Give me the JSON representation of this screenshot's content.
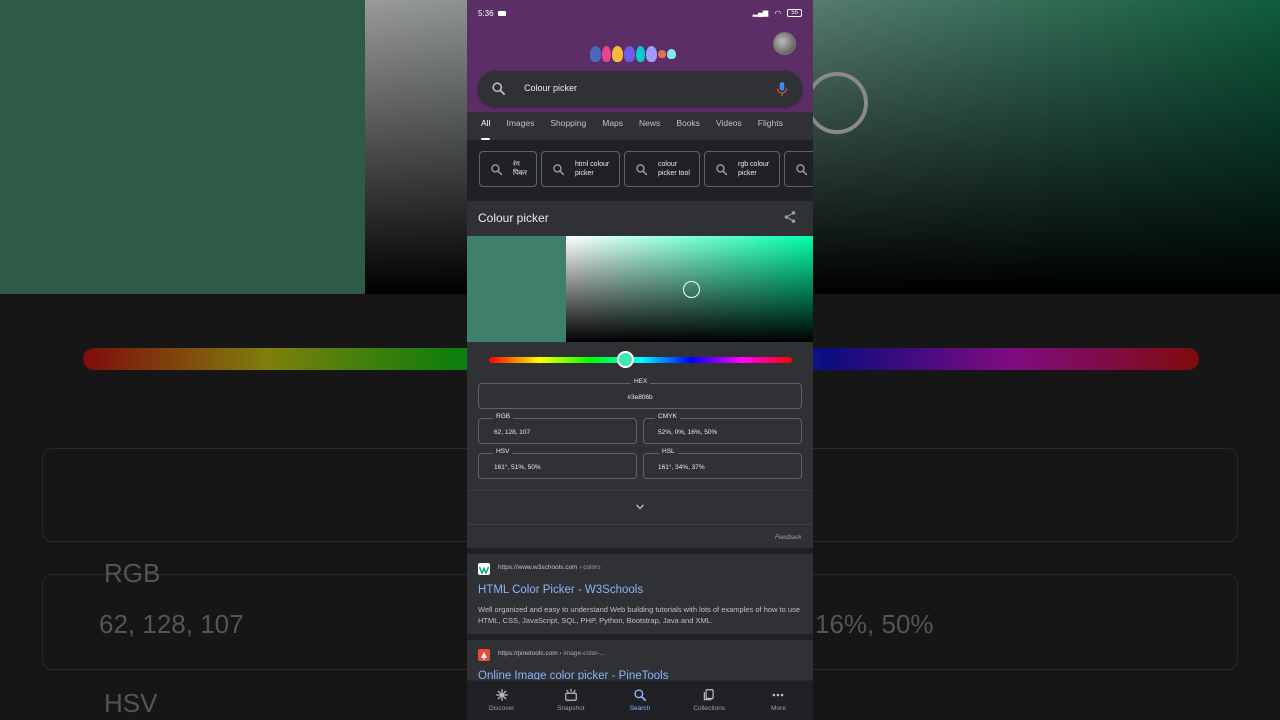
{
  "background": {
    "labels": [
      "RGB",
      "HSV"
    ],
    "values": [
      "62, 128, 107",
      "16%, 50%"
    ]
  },
  "status_bar": {
    "time": "5:36",
    "battery": "55"
  },
  "search": {
    "query": "Colour picker",
    "icon": "search-icon",
    "mic_icon": "mic-icon"
  },
  "tabs": [
    {
      "label": "All",
      "active": true
    },
    {
      "label": "Images"
    },
    {
      "label": "Shopping"
    },
    {
      "label": "Maps"
    },
    {
      "label": "News"
    },
    {
      "label": "Books"
    },
    {
      "label": "Videos"
    },
    {
      "label": "Flights"
    }
  ],
  "chips": [
    {
      "line1": "रंग",
      "line2": "पिकर"
    },
    {
      "line1": "html colour",
      "line2": "picker"
    },
    {
      "line1": "colour",
      "line2": "picker tool"
    },
    {
      "line1": "rgb colour",
      "line2": "picker"
    },
    {
      "line1": "",
      "line2": ""
    }
  ],
  "color_picker": {
    "title": "Colour picker",
    "current_color": "#3e806b",
    "hue_color": "#00ffa8",
    "hue_position": 0.45,
    "saturation": 0.51,
    "value": 0.5,
    "fields": {
      "hex": {
        "label": "HEX",
        "value": "#3e806b"
      },
      "rgb": {
        "label": "RGB",
        "value": "62, 128, 107"
      },
      "cmyk": {
        "label": "CMYK",
        "value": "52%, 0%, 16%, 50%"
      },
      "hsv": {
        "label": "HSV",
        "value": "161°, 51%, 50%"
      },
      "hsl": {
        "label": "HSL",
        "value": "161°, 34%, 37%"
      }
    },
    "feedback": "Feedback"
  },
  "results": [
    {
      "url": "https://www.w3schools.com",
      "crumb": " › colors",
      "title": "HTML Color Picker - W3Schools",
      "description": "Well organized and easy to understand Web building tutorials with lots of examples of how to use HTML, CSS, JavaScript, SQL, PHP, Python, Bootstrap, Java and XML.",
      "favicon_color": "#04aa6d"
    },
    {
      "url": "https://pinetools.com",
      "crumb": " › image-color-...",
      "title": "Online Image color picker - PineTools",
      "favicon_color": "#e74c3c"
    }
  ],
  "bottom_nav": [
    {
      "label": "Discover",
      "icon": "asterisk-icon"
    },
    {
      "label": "Snapshot",
      "icon": "snapshot-icon"
    },
    {
      "label": "Search",
      "icon": "search-icon",
      "active": true
    },
    {
      "label": "Collections",
      "icon": "collections-icon"
    },
    {
      "label": "More",
      "icon": "more-icon"
    }
  ]
}
